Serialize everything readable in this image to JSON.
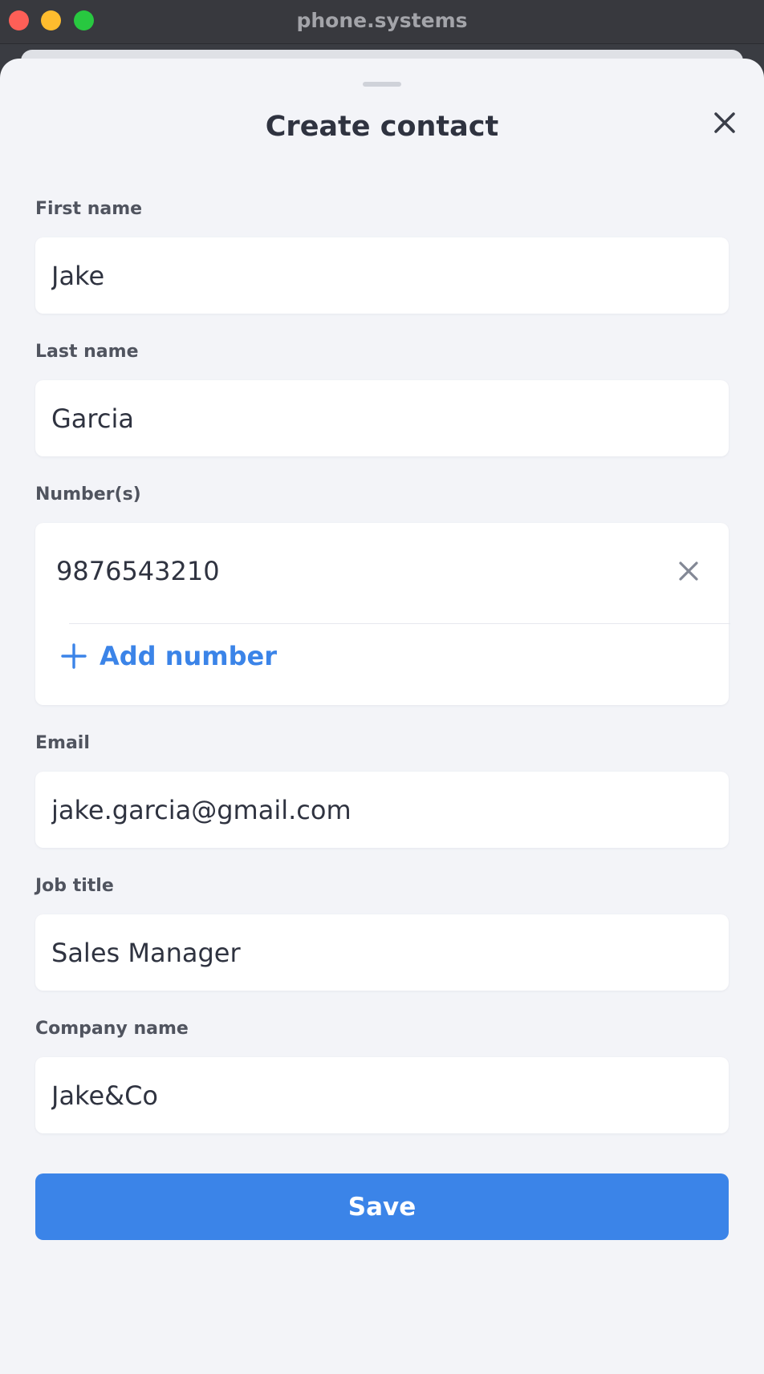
{
  "window": {
    "title": "phone.systems"
  },
  "sheet": {
    "title": "Create contact"
  },
  "fields": {
    "first_name": {
      "label": "First name",
      "value": "Jake"
    },
    "last_name": {
      "label": "Last name",
      "value": "Garcia"
    },
    "numbers": {
      "label": "Number(s)",
      "items": [
        "9876543210"
      ],
      "add_label": "Add number"
    },
    "email": {
      "label": "Email",
      "value": "jake.garcia@gmail.com"
    },
    "job_title": {
      "label": "Job title",
      "value": "Sales Manager"
    },
    "company_name": {
      "label": "Company name",
      "value": "Jake&Co"
    }
  },
  "actions": {
    "save_label": "Save"
  },
  "icons": {
    "close": "close-icon",
    "remove_number": "remove-number-icon",
    "add": "plus-icon"
  },
  "colors": {
    "accent": "#3b84e8",
    "sheet_background": "#f3f4f8",
    "field_background": "#ffffff",
    "text": "#2f3340",
    "label": "#50545f"
  }
}
